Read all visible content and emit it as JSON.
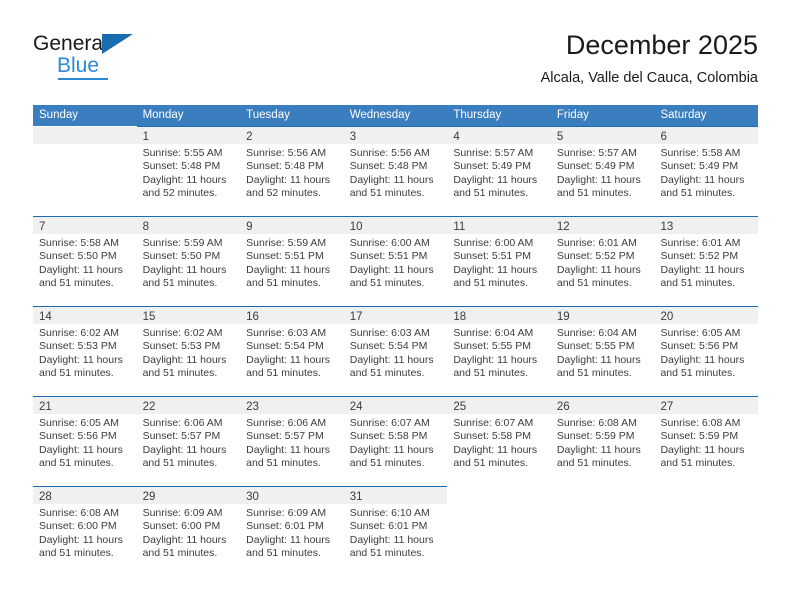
{
  "brand": {
    "name_part1": "General",
    "name_part2": "Blue",
    "triangle_icon": "blue-triangle-icon",
    "accent_color": "#1a6bb0",
    "blue_color": "#2b8ad6"
  },
  "header": {
    "title": "December 2025",
    "subtitle": "Alcala, Valle del Cauca, Colombia"
  },
  "calendar": {
    "header_bg": "#3a7ebf",
    "header_text_color": "#ffffff",
    "daynum_band_bg": "#f0f0f0",
    "row_border_color": "#1a6bb0",
    "weekdays": [
      "Sunday",
      "Monday",
      "Tuesday",
      "Wednesday",
      "Thursday",
      "Friday",
      "Saturday"
    ],
    "weeks": [
      [
        {
          "day": "",
          "lines": []
        },
        {
          "day": "1",
          "lines": [
            "Sunrise: 5:55 AM",
            "Sunset: 5:48 PM",
            "Daylight: 11 hours and 52 minutes."
          ]
        },
        {
          "day": "2",
          "lines": [
            "Sunrise: 5:56 AM",
            "Sunset: 5:48 PM",
            "Daylight: 11 hours and 52 minutes."
          ]
        },
        {
          "day": "3",
          "lines": [
            "Sunrise: 5:56 AM",
            "Sunset: 5:48 PM",
            "Daylight: 11 hours and 51 minutes."
          ]
        },
        {
          "day": "4",
          "lines": [
            "Sunrise: 5:57 AM",
            "Sunset: 5:49 PM",
            "Daylight: 11 hours and 51 minutes."
          ]
        },
        {
          "day": "5",
          "lines": [
            "Sunrise: 5:57 AM",
            "Sunset: 5:49 PM",
            "Daylight: 11 hours and 51 minutes."
          ]
        },
        {
          "day": "6",
          "lines": [
            "Sunrise: 5:58 AM",
            "Sunset: 5:49 PM",
            "Daylight: 11 hours and 51 minutes."
          ]
        }
      ],
      [
        {
          "day": "7",
          "lines": [
            "Sunrise: 5:58 AM",
            "Sunset: 5:50 PM",
            "Daylight: 11 hours and 51 minutes."
          ]
        },
        {
          "day": "8",
          "lines": [
            "Sunrise: 5:59 AM",
            "Sunset: 5:50 PM",
            "Daylight: 11 hours and 51 minutes."
          ]
        },
        {
          "day": "9",
          "lines": [
            "Sunrise: 5:59 AM",
            "Sunset: 5:51 PM",
            "Daylight: 11 hours and 51 minutes."
          ]
        },
        {
          "day": "10",
          "lines": [
            "Sunrise: 6:00 AM",
            "Sunset: 5:51 PM",
            "Daylight: 11 hours and 51 minutes."
          ]
        },
        {
          "day": "11",
          "lines": [
            "Sunrise: 6:00 AM",
            "Sunset: 5:51 PM",
            "Daylight: 11 hours and 51 minutes."
          ]
        },
        {
          "day": "12",
          "lines": [
            "Sunrise: 6:01 AM",
            "Sunset: 5:52 PM",
            "Daylight: 11 hours and 51 minutes."
          ]
        },
        {
          "day": "13",
          "lines": [
            "Sunrise: 6:01 AM",
            "Sunset: 5:52 PM",
            "Daylight: 11 hours and 51 minutes."
          ]
        }
      ],
      [
        {
          "day": "14",
          "lines": [
            "Sunrise: 6:02 AM",
            "Sunset: 5:53 PM",
            "Daylight: 11 hours and 51 minutes."
          ]
        },
        {
          "day": "15",
          "lines": [
            "Sunrise: 6:02 AM",
            "Sunset: 5:53 PM",
            "Daylight: 11 hours and 51 minutes."
          ]
        },
        {
          "day": "16",
          "lines": [
            "Sunrise: 6:03 AM",
            "Sunset: 5:54 PM",
            "Daylight: 11 hours and 51 minutes."
          ]
        },
        {
          "day": "17",
          "lines": [
            "Sunrise: 6:03 AM",
            "Sunset: 5:54 PM",
            "Daylight: 11 hours and 51 minutes."
          ]
        },
        {
          "day": "18",
          "lines": [
            "Sunrise: 6:04 AM",
            "Sunset: 5:55 PM",
            "Daylight: 11 hours and 51 minutes."
          ]
        },
        {
          "day": "19",
          "lines": [
            "Sunrise: 6:04 AM",
            "Sunset: 5:55 PM",
            "Daylight: 11 hours and 51 minutes."
          ]
        },
        {
          "day": "20",
          "lines": [
            "Sunrise: 6:05 AM",
            "Sunset: 5:56 PM",
            "Daylight: 11 hours and 51 minutes."
          ]
        }
      ],
      [
        {
          "day": "21",
          "lines": [
            "Sunrise: 6:05 AM",
            "Sunset: 5:56 PM",
            "Daylight: 11 hours and 51 minutes."
          ]
        },
        {
          "day": "22",
          "lines": [
            "Sunrise: 6:06 AM",
            "Sunset: 5:57 PM",
            "Daylight: 11 hours and 51 minutes."
          ]
        },
        {
          "day": "23",
          "lines": [
            "Sunrise: 6:06 AM",
            "Sunset: 5:57 PM",
            "Daylight: 11 hours and 51 minutes."
          ]
        },
        {
          "day": "24",
          "lines": [
            "Sunrise: 6:07 AM",
            "Sunset: 5:58 PM",
            "Daylight: 11 hours and 51 minutes."
          ]
        },
        {
          "day": "25",
          "lines": [
            "Sunrise: 6:07 AM",
            "Sunset: 5:58 PM",
            "Daylight: 11 hours and 51 minutes."
          ]
        },
        {
          "day": "26",
          "lines": [
            "Sunrise: 6:08 AM",
            "Sunset: 5:59 PM",
            "Daylight: 11 hours and 51 minutes."
          ]
        },
        {
          "day": "27",
          "lines": [
            "Sunrise: 6:08 AM",
            "Sunset: 5:59 PM",
            "Daylight: 11 hours and 51 minutes."
          ]
        }
      ],
      [
        {
          "day": "28",
          "lines": [
            "Sunrise: 6:08 AM",
            "Sunset: 6:00 PM",
            "Daylight: 11 hours and 51 minutes."
          ]
        },
        {
          "day": "29",
          "lines": [
            "Sunrise: 6:09 AM",
            "Sunset: 6:00 PM",
            "Daylight: 11 hours and 51 minutes."
          ]
        },
        {
          "day": "30",
          "lines": [
            "Sunrise: 6:09 AM",
            "Sunset: 6:01 PM",
            "Daylight: 11 hours and 51 minutes."
          ]
        },
        {
          "day": "31",
          "lines": [
            "Sunrise: 6:10 AM",
            "Sunset: 6:01 PM",
            "Daylight: 11 hours and 51 minutes."
          ]
        },
        {
          "day": "",
          "lines": []
        },
        {
          "day": "",
          "lines": []
        },
        {
          "day": "",
          "lines": []
        }
      ]
    ]
  }
}
